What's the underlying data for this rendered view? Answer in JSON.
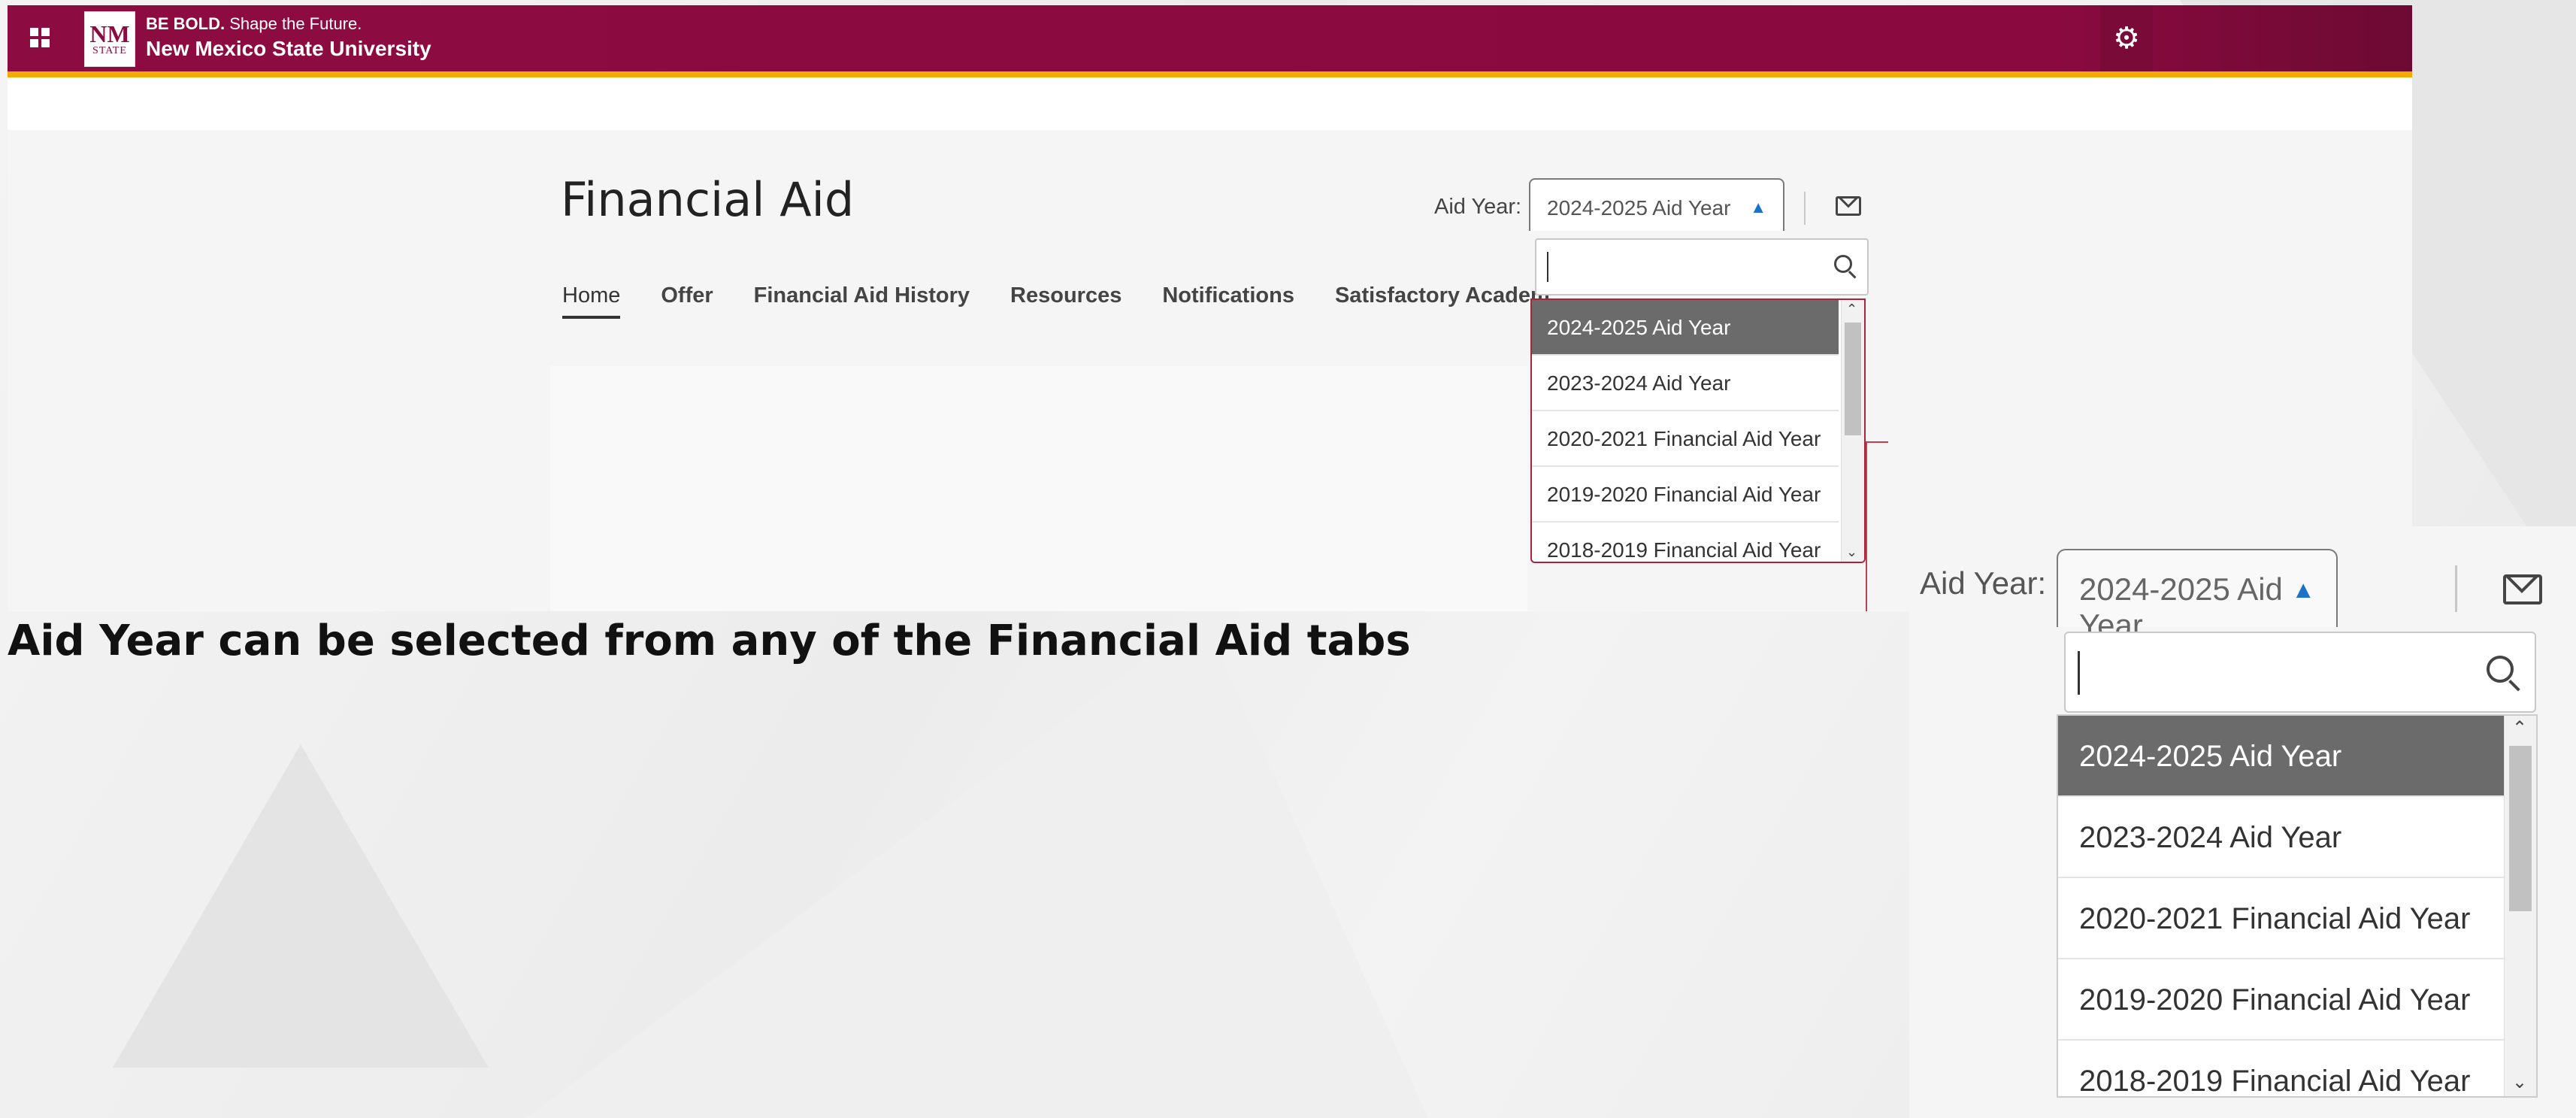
{
  "header": {
    "tagline_bold": "BE BOLD.",
    "tagline_rest": " Shape the Future.",
    "university": "New Mexico State University",
    "logo_text": "NM",
    "logo_sub": "STATE",
    "brand_color": "#8c0b40",
    "accent_stripe": "#f2a900"
  },
  "page": {
    "title": "Financial Aid",
    "tabs": [
      {
        "label": "Home",
        "active": true
      },
      {
        "label": "Offer"
      },
      {
        "label": "Financial Aid History"
      },
      {
        "label": "Resources"
      },
      {
        "label": "Notifications"
      },
      {
        "label": "Satisfactory Academ"
      }
    ]
  },
  "aid_year": {
    "label": "Aid Year:",
    "selected": "2024-2025 Aid Year",
    "search_placeholder": "",
    "options": [
      "2024-2025 Aid Year",
      "2023-2024 Aid Year",
      "2020-2021 Financial Aid Year",
      "2019-2020 Financial Aid Year",
      "2018-2019 Financial Aid Year"
    ]
  },
  "caption": "Aid Year can be selected from any of the Financial Aid tabs",
  "icons": [
    "apps-grid-icon",
    "gear-icon",
    "chevron-up-icon",
    "mail-icon",
    "search-icon",
    "scroll-up-icon",
    "scroll-down-icon"
  ]
}
